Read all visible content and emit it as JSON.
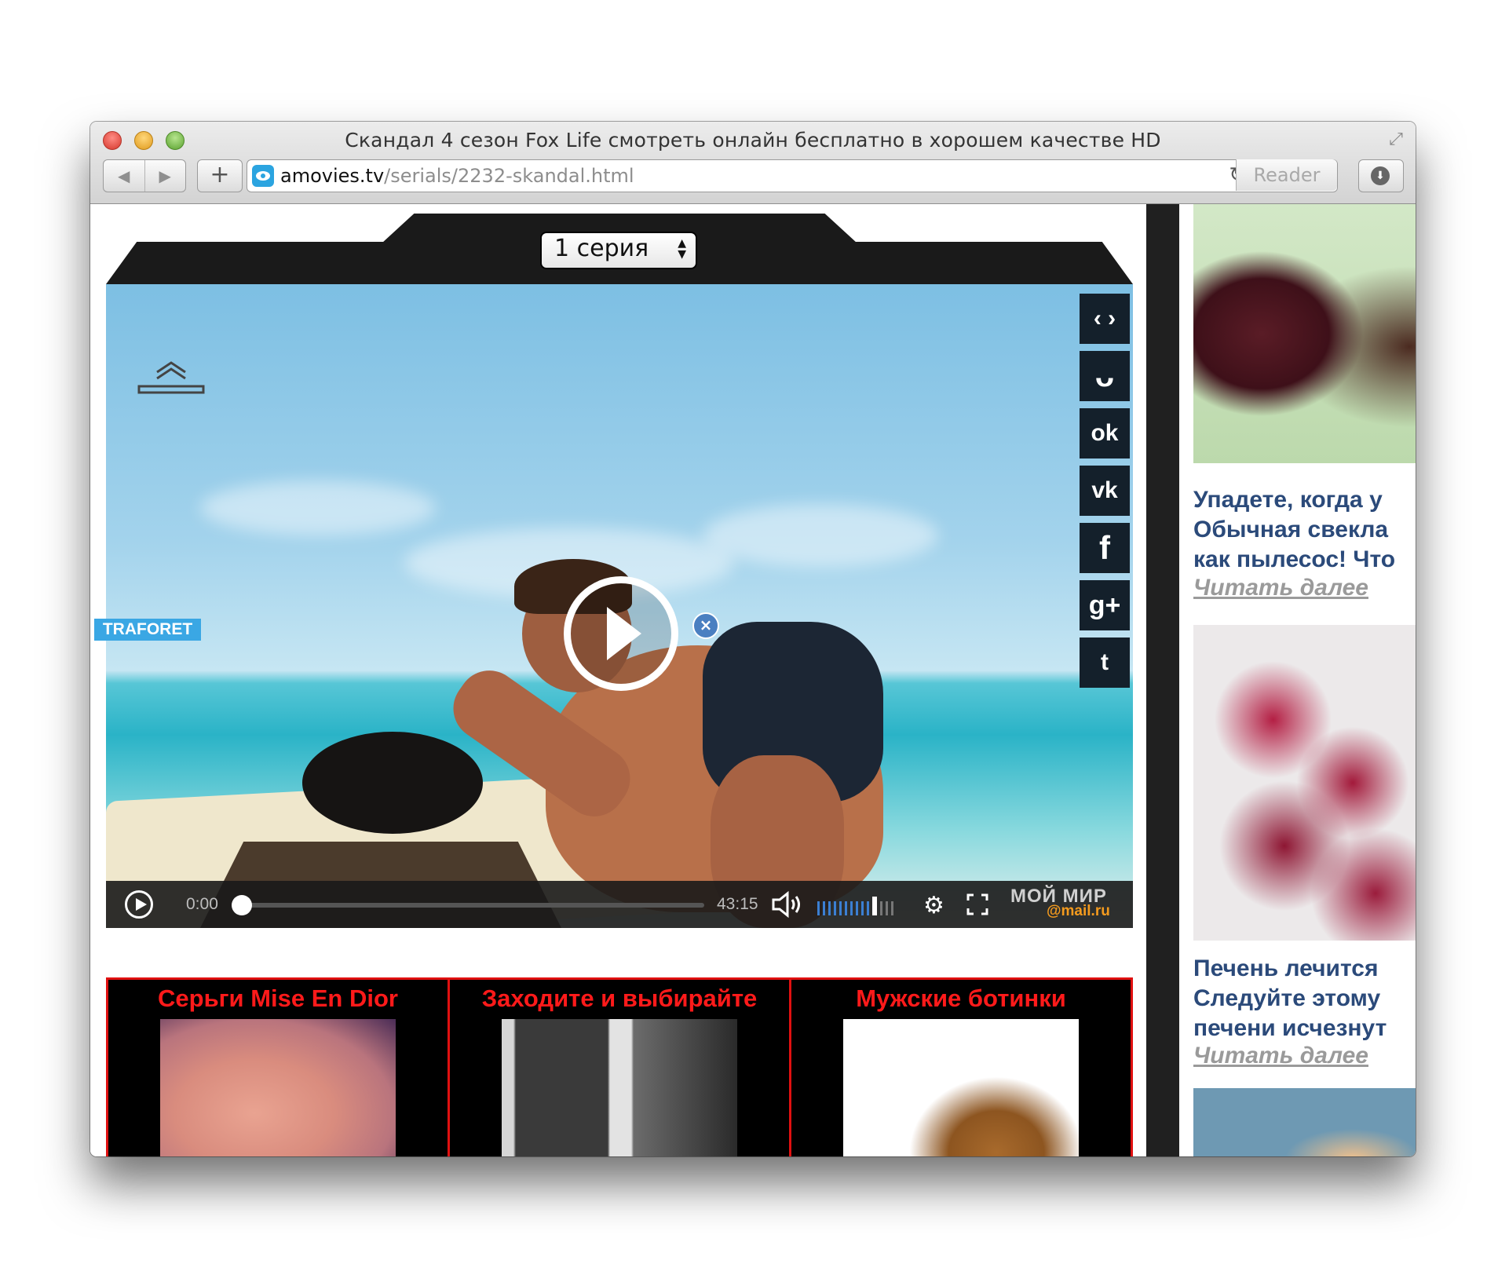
{
  "window": {
    "title": "Скандал 4 сезон Fox Life смотреть онлайн бесплатно в хорошем качестве HD",
    "url_domain": "amovies.tv",
    "url_path": "/serials/2232-skandal.html",
    "reader_label": "Reader",
    "add_label": "+",
    "back_glyph": "◀",
    "forward_glyph": "▶",
    "reload_glyph": "↻"
  },
  "player": {
    "series_label": "1 серия",
    "current_time": "0:00",
    "duration": "43:15",
    "progress": 0.0,
    "volume_level": 0.7,
    "brand_line1": "МОЙ МИР",
    "brand_line2": "@mail.ru",
    "traforet": "TRAFORET",
    "share_buttons": [
      {
        "name": "embed",
        "glyph": "‹ ›"
      },
      {
        "name": "moimir",
        "glyph": "ᴗ"
      },
      {
        "name": "odnoklassniki",
        "glyph": "ok"
      },
      {
        "name": "vk",
        "glyph": "vk"
      },
      {
        "name": "facebook",
        "glyph": "f"
      },
      {
        "name": "google-plus",
        "glyph": "g+"
      },
      {
        "name": "twitter",
        "glyph": "t"
      }
    ]
  },
  "ads": [
    {
      "title": "Серьги Mise En Dior"
    },
    {
      "title": "Заходите и выбирайте"
    },
    {
      "title": "Мужские ботинки"
    }
  ],
  "news": [
    {
      "title": "Упадете, когда у\nОбычная свекла\nкак пылесос! Что",
      "more": "Читать далее"
    },
    {
      "title": "Печень лечится \nСледуйте этому \nпечени исчезнут",
      "more": "Читать далее"
    }
  ]
}
